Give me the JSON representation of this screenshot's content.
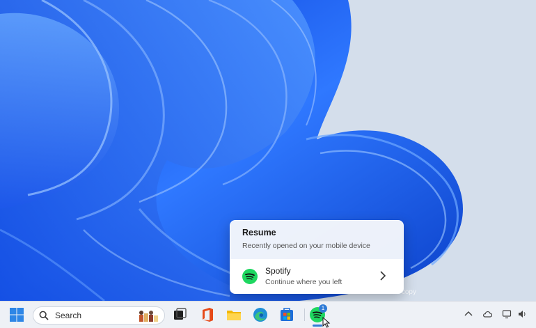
{
  "popup": {
    "title": "Resume",
    "subtitle": "Recently opened on your mobile device",
    "app": {
      "name": "Spotify",
      "detail": "Continue where you left",
      "icon": "spotify-icon"
    }
  },
  "taskbar": {
    "search_placeholder": "Search",
    "pinned_apps": [
      "start-icon",
      "task-view-icon",
      "office-icon",
      "file-explorer-icon",
      "edge-icon",
      "microsoft-store-icon",
      "spotify-icon"
    ],
    "active_app_badge": "1",
    "tray_icons": [
      "chevron-up-icon",
      "cloud-icon",
      "display-icon",
      "volume-icon"
    ]
  },
  "watermark": "Evaluation copy",
  "colors": {
    "accent": "#2f7bd6",
    "spotify": "#1ed760",
    "wallpaper_blue": "#1e5cf0"
  }
}
